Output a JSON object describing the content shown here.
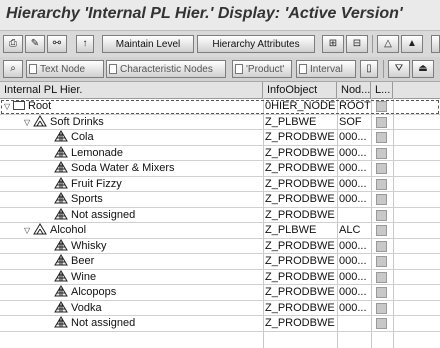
{
  "window": {
    "title": "Hierarchy 'Internal PL Hier.' Display: 'Active Version'"
  },
  "toolbar1": {
    "maintain_level": "Maintain Level",
    "hierarchy_attributes": "Hierarchy Attributes"
  },
  "toolbar2": {
    "text_node": "Text Node",
    "characteristic_nodes": "Characteristic Nodes",
    "product": "'Product'",
    "interval": "Interval"
  },
  "grid": {
    "columns": [
      "Internal PL Hier.",
      "InfoObject",
      "Nod...",
      "L..."
    ],
    "rows": [
      {
        "label": "Root",
        "infoobject": "0HIER_NODE",
        "node": "ROOT",
        "level": 0,
        "kind": "root"
      },
      {
        "label": "Soft Drinks",
        "infoobject": "Z_PLBWE",
        "node": "SOF",
        "level": 1,
        "kind": "group"
      },
      {
        "label": "Cola",
        "infoobject": "Z_PRODBWE",
        "node": "000...",
        "level": 2,
        "kind": "leaf"
      },
      {
        "label": "Lemonade",
        "infoobject": "Z_PRODBWE",
        "node": "000...",
        "level": 2,
        "kind": "leaf"
      },
      {
        "label": "Soda Water & Mixers",
        "infoobject": "Z_PRODBWE",
        "node": "000...",
        "level": 2,
        "kind": "leaf"
      },
      {
        "label": "Fruit Fizzy",
        "infoobject": "Z_PRODBWE",
        "node": "000...",
        "level": 2,
        "kind": "leaf"
      },
      {
        "label": "Sports",
        "infoobject": "Z_PRODBWE",
        "node": "000...",
        "level": 2,
        "kind": "leaf"
      },
      {
        "label": "Not assigned",
        "infoobject": "Z_PRODBWE",
        "node": "",
        "level": 2,
        "kind": "leaf"
      },
      {
        "label": "Alcohol",
        "infoobject": "Z_PLBWE",
        "node": "ALC",
        "level": 1,
        "kind": "group"
      },
      {
        "label": "Whisky",
        "infoobject": "Z_PRODBWE",
        "node": "000...",
        "level": 2,
        "kind": "leaf"
      },
      {
        "label": "Beer",
        "infoobject": "Z_PRODBWE",
        "node": "000...",
        "level": 2,
        "kind": "leaf"
      },
      {
        "label": "Wine",
        "infoobject": "Z_PRODBWE",
        "node": "000...",
        "level": 2,
        "kind": "leaf"
      },
      {
        "label": "Alcopops",
        "infoobject": "Z_PRODBWE",
        "node": "000...",
        "level": 2,
        "kind": "leaf"
      },
      {
        "label": "Vodka",
        "infoobject": "Z_PRODBWE",
        "node": "000...",
        "level": 2,
        "kind": "leaf"
      },
      {
        "label": "Not assigned",
        "infoobject": "Z_PRODBWE",
        "node": "",
        "level": 2,
        "kind": "leaf"
      }
    ]
  }
}
